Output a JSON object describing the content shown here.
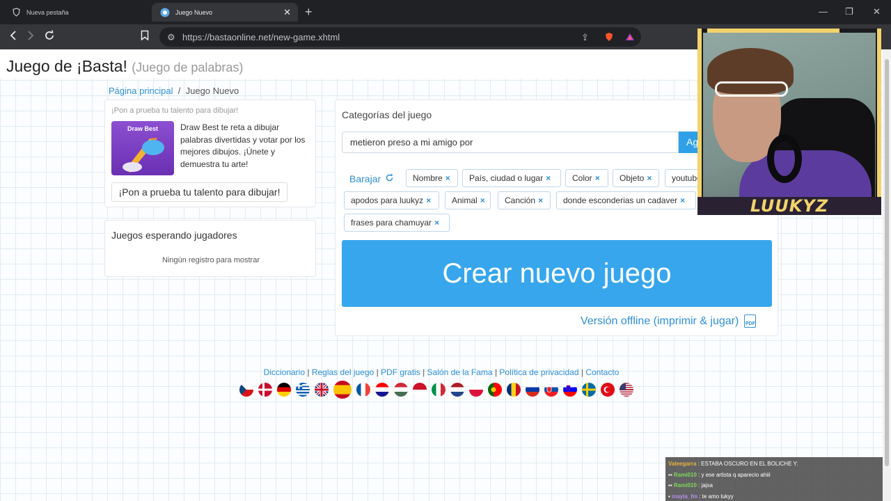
{
  "browser": {
    "tabs": [
      {
        "title": "Nueva pestaña"
      },
      {
        "title": "Juego Nuevo"
      }
    ],
    "url": "https://bastaonline.net/new-game.xhtml"
  },
  "site": {
    "title": "Juego de ¡Basta!",
    "subtitle": "(Juego de palabras)"
  },
  "breadcrumb": {
    "home": "Página principal",
    "separator": "/",
    "current": "Juego Nuevo"
  },
  "promo": {
    "heading": "¡Pon a prueba tu talento para dibujar!",
    "image_label": "Draw Best",
    "description": "Draw Best te reta a dibujar palabras divertidas y votar por los mejores dibujos. ¡Únete y demuestra tu arte!",
    "button": "¡Pon a prueba tu talento para dibujar!"
  },
  "waiting": {
    "title": "Juegos esperando jugadores",
    "empty": "Ningún registro para mostrar"
  },
  "categories": {
    "title": "Categorías del juego",
    "input_value": "metieron preso a mi amigo por",
    "add_button": "Agregar",
    "shuffle": "Barajar",
    "chips": [
      "Nombre",
      "País, ciudad o lugar",
      "Color",
      "Objeto",
      "youtuber",
      "apodos para luukyz",
      "Animal",
      "Canción",
      "donde esconderias un cadaver",
      "frases para chamuyar"
    ],
    "create_button": "Crear nuevo juego",
    "offline_link": "Versión offline (imprimir & jugar)",
    "pdf_label": "PDF"
  },
  "footer": {
    "links": [
      "Diccionario",
      "Reglas del juego",
      "PDF gratis",
      "Salón de la Fama",
      "Política de privacidad",
      "Contacto"
    ],
    "separator": "|",
    "flags": [
      "cz",
      "dk",
      "de",
      "gr",
      "gb",
      "es",
      "fr",
      "hr",
      "hu",
      "id",
      "it",
      "nl",
      "pl",
      "pt",
      "ro",
      "ru",
      "sk",
      "si",
      "se",
      "tr",
      "us"
    ]
  },
  "stream": {
    "name": "LUUKYZ",
    "chat": [
      {
        "user": "Valeegarra",
        "text": "ESTABA OSCURO EN EL BOLICHE Y:",
        "color": "#e7b43a"
      },
      {
        "user": "Rami010",
        "text": "y ese artista q aparecio ahiii",
        "color": "#7ed957"
      },
      {
        "user": "Rami010",
        "text": "jajsa",
        "color": "#7ed957"
      },
      {
        "user": "mayla_fm",
        "text": "te amo lukyy",
        "color": "#b58cf2"
      }
    ]
  },
  "colors": {
    "accent": "#37a6ed",
    "link": "#2f8fd6",
    "stream_gold": "#f2d36b"
  }
}
